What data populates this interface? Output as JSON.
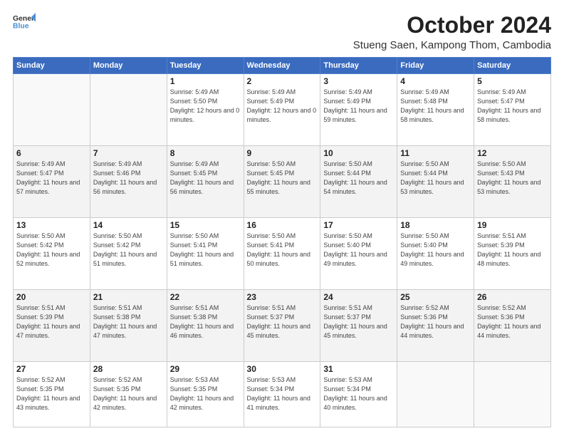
{
  "header": {
    "logo_line1": "General",
    "logo_line2": "Blue",
    "month": "October 2024",
    "location": "Stueng Saen, Kampong Thom, Cambodia"
  },
  "weekdays": [
    "Sunday",
    "Monday",
    "Tuesday",
    "Wednesday",
    "Thursday",
    "Friday",
    "Saturday"
  ],
  "weeks": [
    [
      {
        "day": "",
        "sunrise": "",
        "sunset": "",
        "daylight": ""
      },
      {
        "day": "",
        "sunrise": "",
        "sunset": "",
        "daylight": ""
      },
      {
        "day": "1",
        "sunrise": "Sunrise: 5:49 AM",
        "sunset": "Sunset: 5:50 PM",
        "daylight": "Daylight: 12 hours and 0 minutes."
      },
      {
        "day": "2",
        "sunrise": "Sunrise: 5:49 AM",
        "sunset": "Sunset: 5:49 PM",
        "daylight": "Daylight: 12 hours and 0 minutes."
      },
      {
        "day": "3",
        "sunrise": "Sunrise: 5:49 AM",
        "sunset": "Sunset: 5:49 PM",
        "daylight": "Daylight: 11 hours and 59 minutes."
      },
      {
        "day": "4",
        "sunrise": "Sunrise: 5:49 AM",
        "sunset": "Sunset: 5:48 PM",
        "daylight": "Daylight: 11 hours and 58 minutes."
      },
      {
        "day": "5",
        "sunrise": "Sunrise: 5:49 AM",
        "sunset": "Sunset: 5:47 PM",
        "daylight": "Daylight: 11 hours and 58 minutes."
      }
    ],
    [
      {
        "day": "6",
        "sunrise": "Sunrise: 5:49 AM",
        "sunset": "Sunset: 5:47 PM",
        "daylight": "Daylight: 11 hours and 57 minutes."
      },
      {
        "day": "7",
        "sunrise": "Sunrise: 5:49 AM",
        "sunset": "Sunset: 5:46 PM",
        "daylight": "Daylight: 11 hours and 56 minutes."
      },
      {
        "day": "8",
        "sunrise": "Sunrise: 5:49 AM",
        "sunset": "Sunset: 5:45 PM",
        "daylight": "Daylight: 11 hours and 56 minutes."
      },
      {
        "day": "9",
        "sunrise": "Sunrise: 5:50 AM",
        "sunset": "Sunset: 5:45 PM",
        "daylight": "Daylight: 11 hours and 55 minutes."
      },
      {
        "day": "10",
        "sunrise": "Sunrise: 5:50 AM",
        "sunset": "Sunset: 5:44 PM",
        "daylight": "Daylight: 11 hours and 54 minutes."
      },
      {
        "day": "11",
        "sunrise": "Sunrise: 5:50 AM",
        "sunset": "Sunset: 5:44 PM",
        "daylight": "Daylight: 11 hours and 53 minutes."
      },
      {
        "day": "12",
        "sunrise": "Sunrise: 5:50 AM",
        "sunset": "Sunset: 5:43 PM",
        "daylight": "Daylight: 11 hours and 53 minutes."
      }
    ],
    [
      {
        "day": "13",
        "sunrise": "Sunrise: 5:50 AM",
        "sunset": "Sunset: 5:42 PM",
        "daylight": "Daylight: 11 hours and 52 minutes."
      },
      {
        "day": "14",
        "sunrise": "Sunrise: 5:50 AM",
        "sunset": "Sunset: 5:42 PM",
        "daylight": "Daylight: 11 hours and 51 minutes."
      },
      {
        "day": "15",
        "sunrise": "Sunrise: 5:50 AM",
        "sunset": "Sunset: 5:41 PM",
        "daylight": "Daylight: 11 hours and 51 minutes."
      },
      {
        "day": "16",
        "sunrise": "Sunrise: 5:50 AM",
        "sunset": "Sunset: 5:41 PM",
        "daylight": "Daylight: 11 hours and 50 minutes."
      },
      {
        "day": "17",
        "sunrise": "Sunrise: 5:50 AM",
        "sunset": "Sunset: 5:40 PM",
        "daylight": "Daylight: 11 hours and 49 minutes."
      },
      {
        "day": "18",
        "sunrise": "Sunrise: 5:50 AM",
        "sunset": "Sunset: 5:40 PM",
        "daylight": "Daylight: 11 hours and 49 minutes."
      },
      {
        "day": "19",
        "sunrise": "Sunrise: 5:51 AM",
        "sunset": "Sunset: 5:39 PM",
        "daylight": "Daylight: 11 hours and 48 minutes."
      }
    ],
    [
      {
        "day": "20",
        "sunrise": "Sunrise: 5:51 AM",
        "sunset": "Sunset: 5:39 PM",
        "daylight": "Daylight: 11 hours and 47 minutes."
      },
      {
        "day": "21",
        "sunrise": "Sunrise: 5:51 AM",
        "sunset": "Sunset: 5:38 PM",
        "daylight": "Daylight: 11 hours and 47 minutes."
      },
      {
        "day": "22",
        "sunrise": "Sunrise: 5:51 AM",
        "sunset": "Sunset: 5:38 PM",
        "daylight": "Daylight: 11 hours and 46 minutes."
      },
      {
        "day": "23",
        "sunrise": "Sunrise: 5:51 AM",
        "sunset": "Sunset: 5:37 PM",
        "daylight": "Daylight: 11 hours and 45 minutes."
      },
      {
        "day": "24",
        "sunrise": "Sunrise: 5:51 AM",
        "sunset": "Sunset: 5:37 PM",
        "daylight": "Daylight: 11 hours and 45 minutes."
      },
      {
        "day": "25",
        "sunrise": "Sunrise: 5:52 AM",
        "sunset": "Sunset: 5:36 PM",
        "daylight": "Daylight: 11 hours and 44 minutes."
      },
      {
        "day": "26",
        "sunrise": "Sunrise: 5:52 AM",
        "sunset": "Sunset: 5:36 PM",
        "daylight": "Daylight: 11 hours and 44 minutes."
      }
    ],
    [
      {
        "day": "27",
        "sunrise": "Sunrise: 5:52 AM",
        "sunset": "Sunset: 5:35 PM",
        "daylight": "Daylight: 11 hours and 43 minutes."
      },
      {
        "day": "28",
        "sunrise": "Sunrise: 5:52 AM",
        "sunset": "Sunset: 5:35 PM",
        "daylight": "Daylight: 11 hours and 42 minutes."
      },
      {
        "day": "29",
        "sunrise": "Sunrise: 5:53 AM",
        "sunset": "Sunset: 5:35 PM",
        "daylight": "Daylight: 11 hours and 42 minutes."
      },
      {
        "day": "30",
        "sunrise": "Sunrise: 5:53 AM",
        "sunset": "Sunset: 5:34 PM",
        "daylight": "Daylight: 11 hours and 41 minutes."
      },
      {
        "day": "31",
        "sunrise": "Sunrise: 5:53 AM",
        "sunset": "Sunset: 5:34 PM",
        "daylight": "Daylight: 11 hours and 40 minutes."
      },
      {
        "day": "",
        "sunrise": "",
        "sunset": "",
        "daylight": ""
      },
      {
        "day": "",
        "sunrise": "",
        "sunset": "",
        "daylight": ""
      }
    ]
  ]
}
